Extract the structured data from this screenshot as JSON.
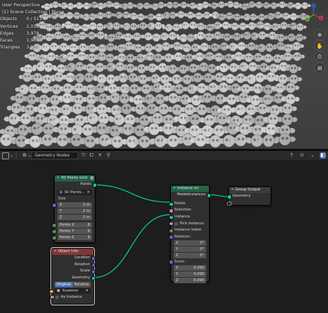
{
  "viewport": {
    "view_name": "User Perspective",
    "collection_line": "(1) Scene Collection | Plane",
    "stats": [
      {
        "label": "Objects",
        "value": "0 / 513"
      },
      {
        "label": "Vertices",
        "value": "2,012"
      },
      {
        "label": "Edges",
        "value": "3,978"
      },
      {
        "label": "Faces",
        "value": "1,968"
      },
      {
        "label": "Triangles",
        "value": "3,936"
      }
    ],
    "gizmo_axes": [
      "Z",
      "Y",
      "X"
    ]
  },
  "editor_header": {
    "tree_name": "Geometry Nodes"
  },
  "nodes": {
    "points_grid": {
      "title": "3D Points Grid",
      "output_points": "Points",
      "size_label": "Size",
      "size": [
        {
          "axis": "X",
          "value": "2 m"
        },
        {
          "axis": "Y",
          "value": "2 m"
        },
        {
          "axis": "Z",
          "value": "2 m"
        }
      ],
      "points_rows": [
        {
          "label": "Points X",
          "value": "8"
        },
        {
          "label": "Points Y",
          "value": "8"
        },
        {
          "label": "Points Z",
          "value": "8"
        }
      ],
      "group_name": "3D Points..."
    },
    "instance_on_points": {
      "title": "Instance on Points",
      "output_instances": "Instances",
      "inputs": [
        "Points",
        "Selection",
        "Instance"
      ],
      "pick_instance": "Pick Instance",
      "instance_index": "Instance Index",
      "rotation_label": "Rotation:",
      "rotation": [
        {
          "axis": "X",
          "value": "0°"
        },
        {
          "axis": "Y",
          "value": "0°"
        },
        {
          "axis": "Z",
          "value": "0°"
        }
      ],
      "scale_label": "Scale:",
      "scale": [
        {
          "axis": "X",
          "value": "0.090"
        },
        {
          "axis": "Y",
          "value": "0.090"
        },
        {
          "axis": "Z",
          "value": "0.090"
        }
      ]
    },
    "group_output": {
      "title": "Group Output",
      "input_geometry": "Geometry"
    },
    "object_info": {
      "title": "Object Info",
      "outputs": [
        "Location",
        "Rotation",
        "Scale",
        "Geometry"
      ],
      "mode_options": [
        "Original",
        "Relative"
      ],
      "mode_selected": "Original",
      "object": "Suzanne",
      "as_instance": "As Instance"
    }
  },
  "colors": {
    "geometry_socket": "#00d6a3",
    "vector_socket": "#6262d1",
    "float_socket": "#a1a1a1",
    "int_socket": "#598c5c",
    "bool_socket": "#cf7cac",
    "geo_header": "#246247",
    "input_header": "#823637",
    "output_header": "#3c3c3c"
  }
}
